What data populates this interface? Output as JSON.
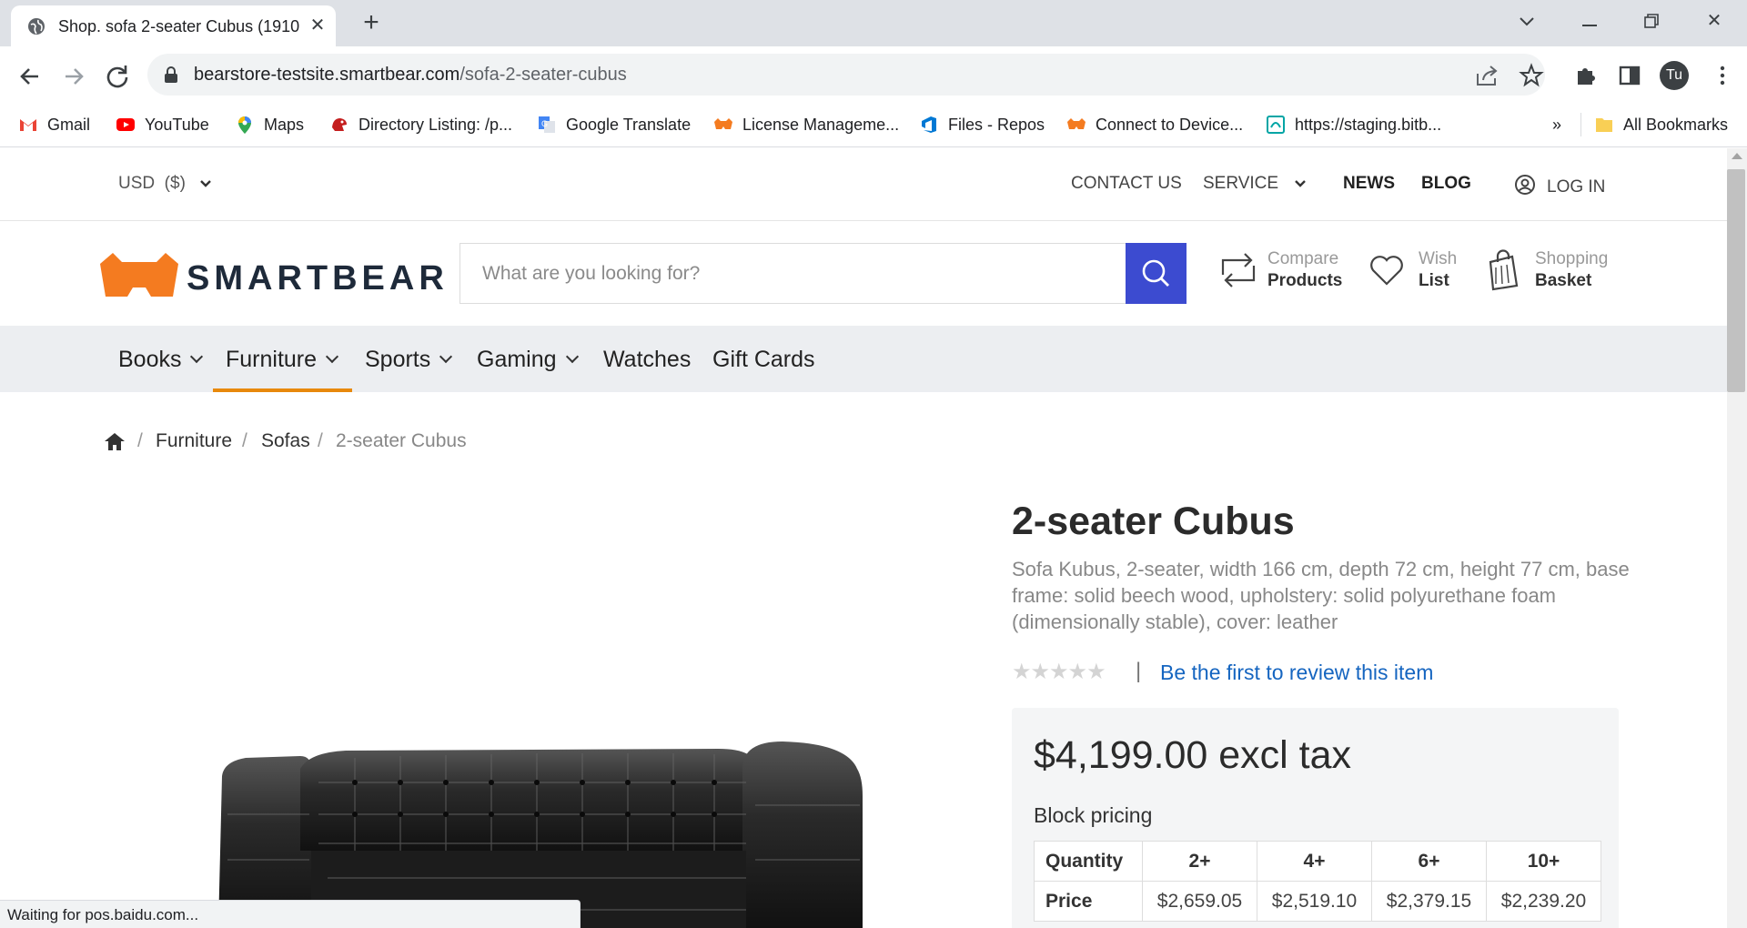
{
  "browser": {
    "tab_title": "Shop. sofa 2-seater Cubus (1910",
    "url_domain": "bearstore-testsite.smartbear.com",
    "url_path": "/sofa-2-seater-cubus",
    "profile_initials": "Tu",
    "bookmarks": [
      {
        "label": "Gmail",
        "icon": "gmail-icon"
      },
      {
        "label": "YouTube",
        "icon": "youtube-icon"
      },
      {
        "label": "Maps",
        "icon": "maps-icon"
      },
      {
        "label": "Directory Listing: /p...",
        "icon": "directory-icon"
      },
      {
        "label": "Google Translate",
        "icon": "translate-icon"
      },
      {
        "label": "License Manageme...",
        "icon": "smartbear-icon"
      },
      {
        "label": "Files - Repos",
        "icon": "azure-devops-icon"
      },
      {
        "label": "Connect to Device...",
        "icon": "smartbear-icon"
      },
      {
        "label": "https://staging.bitb...",
        "icon": "bitbar-icon"
      }
    ],
    "bookmarks_overflow": "»",
    "all_bookmarks": "All Bookmarks",
    "status_text": "Waiting for pos.baidu.com..."
  },
  "site": {
    "currency": "USD  ($)",
    "top_nav": {
      "contact": "CONTACT US",
      "service": "SERVICE",
      "news": "NEWS",
      "blog": "BLOG",
      "login": "LOG IN"
    },
    "logo_text": "SMARTBEAR",
    "search_placeholder": "What are you looking for?",
    "compare": {
      "line1": "Compare",
      "line2": "Products"
    },
    "wishlist": {
      "line1": "Wish",
      "line2": "List"
    },
    "basket": {
      "line1": "Shopping",
      "line2": "Basket"
    },
    "categories": [
      {
        "label": "Books",
        "has_menu": true
      },
      {
        "label": "Furniture",
        "has_menu": true
      },
      {
        "label": "Sports",
        "has_menu": true
      },
      {
        "label": "Gaming",
        "has_menu": true
      },
      {
        "label": "Watches",
        "has_menu": false
      },
      {
        "label": "Gift Cards",
        "has_menu": false
      }
    ],
    "active_category": "Furniture",
    "accent": "#e8890c",
    "brand_blue": "#3c4bd0"
  },
  "breadcrumb": {
    "items": [
      "Furniture",
      "Sofas"
    ],
    "current": "2-seater Cubus",
    "separator": "/"
  },
  "product": {
    "title": "2-seater Cubus",
    "description": "Sofa Kubus, 2-seater, width 166 cm, depth 72 cm, height 77 cm, base frame: solid beech wood, upholstery: solid polyurethane foam (dimensionally stable), cover: leather",
    "rating": 0,
    "rating_max": 5,
    "review_link": "Be the first to review this item",
    "price": "$4,199.00 excl tax",
    "block_pricing_label": "Block pricing",
    "block_pricing": {
      "quantity_label": "Quantity",
      "price_label": "Price",
      "quantities": [
        "2+",
        "4+",
        "6+",
        "10+"
      ],
      "prices": [
        "$2,659.05",
        "$2,519.10",
        "$2,379.15",
        "$2,239.20"
      ]
    }
  }
}
